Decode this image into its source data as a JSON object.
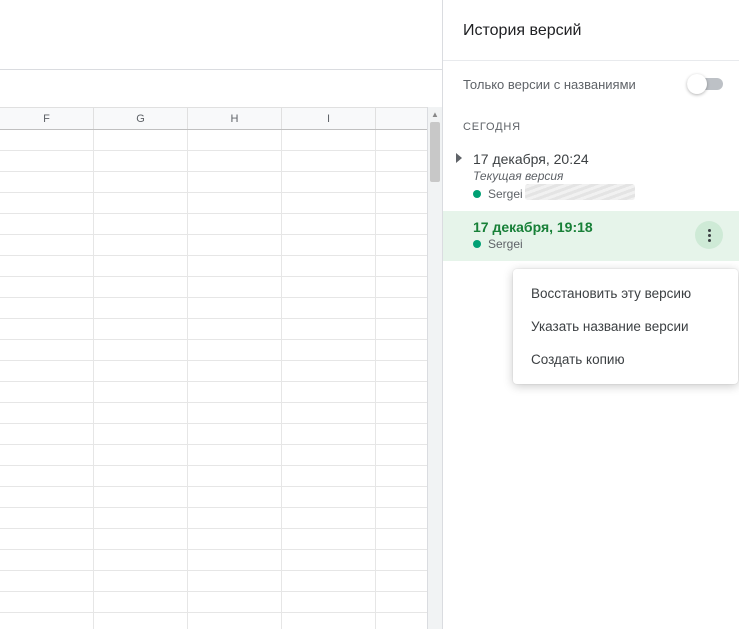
{
  "sheet": {
    "columns": [
      "F",
      "G",
      "H",
      "I",
      ""
    ]
  },
  "panel": {
    "title": "История версий",
    "filter_label": "Только версии с названиями",
    "filter_on": false,
    "sections": [
      {
        "label": "СЕГОДНЯ",
        "versions": [
          {
            "title": "17 декабря, 20:24",
            "subtitle": "Текущая версия",
            "author": "Sergei C",
            "author_color": "#00a074",
            "selected": false,
            "expandable": true,
            "author_masked": true
          },
          {
            "title": "17 декабря, 19:18",
            "subtitle": "",
            "author": "Sergei",
            "author_color": "#00a074",
            "selected": true,
            "expandable": false,
            "author_masked": false
          }
        ]
      }
    ],
    "menu": {
      "restore": "Восстановить эту версию",
      "rename": "Указать название версии",
      "copy": "Создать копию"
    }
  }
}
